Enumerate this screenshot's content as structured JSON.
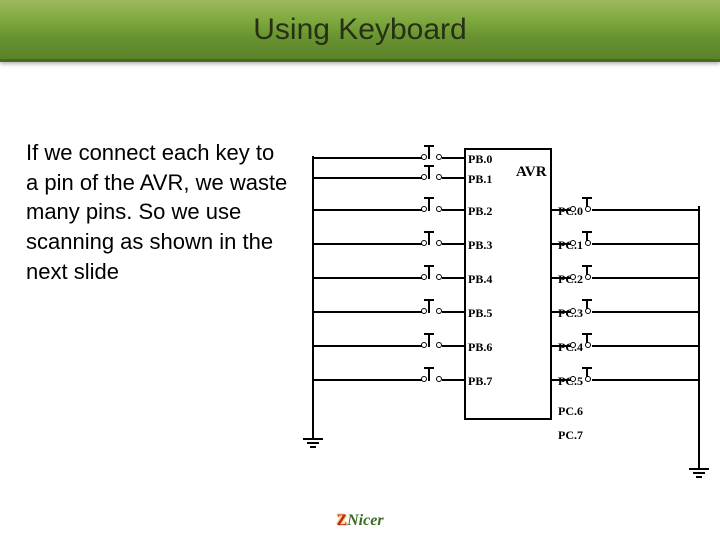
{
  "header": {
    "title": "Using Keyboard"
  },
  "body": {
    "text": "If we connect each key to a pin of the AVR, we waste many pins. So we use scanning as shown in the next slide"
  },
  "diagram": {
    "chip_label": "AVR",
    "left_pins": [
      "PB.0",
      "PB.1",
      "PB.2",
      "PB.3",
      "PB.4",
      "PB.5",
      "PB.6",
      "PB.7"
    ],
    "right_pins": [
      "PC.0",
      "PC.1",
      "PC.2",
      "PC.3",
      "PC.4",
      "PC.5",
      "PC.6",
      "PC.7"
    ]
  },
  "footer": {
    "logo_z": "Z",
    "logo_rest": "Nicer"
  }
}
